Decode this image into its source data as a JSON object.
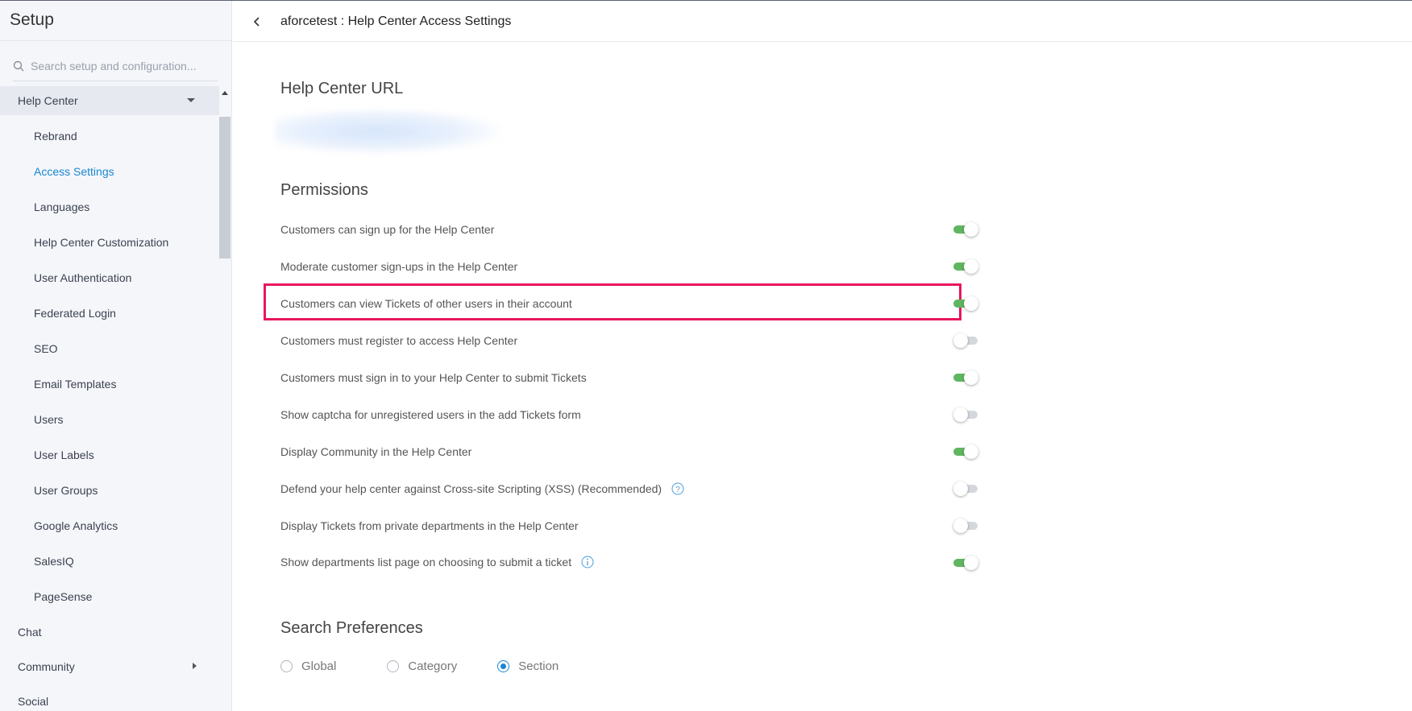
{
  "sidebar": {
    "title": "Setup",
    "search_placeholder": "Search setup and configuration...",
    "items": [
      {
        "label": "Help Center",
        "level": "top",
        "state": "expanded"
      },
      {
        "label": "Rebrand",
        "level": "sub"
      },
      {
        "label": "Access Settings",
        "level": "sub",
        "state": "active"
      },
      {
        "label": "Languages",
        "level": "sub"
      },
      {
        "label": "Help Center Customization",
        "level": "sub"
      },
      {
        "label": "User Authentication",
        "level": "sub"
      },
      {
        "label": "Federated Login",
        "level": "sub"
      },
      {
        "label": "SEO",
        "level": "sub"
      },
      {
        "label": "Email Templates",
        "level": "sub"
      },
      {
        "label": "Users",
        "level": "sub"
      },
      {
        "label": "User Labels",
        "level": "sub"
      },
      {
        "label": "User Groups",
        "level": "sub"
      },
      {
        "label": "Google Analytics",
        "level": "sub"
      },
      {
        "label": "SalesIQ",
        "level": "sub"
      },
      {
        "label": "PageSense",
        "level": "sub"
      },
      {
        "label": "Chat",
        "level": "top"
      },
      {
        "label": "Community",
        "level": "top",
        "state": "collapsed"
      },
      {
        "label": "Social",
        "level": "top"
      }
    ]
  },
  "header": {
    "title": "aforcetest : Help Center Access Settings"
  },
  "main": {
    "help_center_url_title": "Help Center URL",
    "permissions_title": "Permissions",
    "permissions": [
      {
        "label": "Customers can sign up for the Help Center",
        "enabled": true
      },
      {
        "label": "Moderate customer sign-ups in the Help Center",
        "enabled": true
      },
      {
        "label": "Customers can view Tickets of other users in their account",
        "enabled": true,
        "highlighted": true
      },
      {
        "label": "Customers must register to access Help Center",
        "enabled": false
      },
      {
        "label": "Customers must sign in to your Help Center to submit Tickets",
        "enabled": true
      },
      {
        "label": "Show captcha for unregistered users in the add Tickets form",
        "enabled": false
      },
      {
        "label": "Display Community in the Help Center",
        "enabled": true
      },
      {
        "label": "Defend your help center against Cross-site Scripting (XSS) (Recommended)",
        "enabled": false,
        "icon": "question-icon"
      },
      {
        "label": "Display Tickets from private departments in the Help Center",
        "enabled": false
      },
      {
        "label": "Show departments list page on choosing to submit a ticket",
        "enabled": true,
        "icon": "info-icon"
      }
    ],
    "search_preferences_title": "Search Preferences",
    "search_options": [
      {
        "label": "Global",
        "selected": false
      },
      {
        "label": "Category",
        "selected": false
      },
      {
        "label": "Section",
        "selected": true
      }
    ]
  },
  "colors": {
    "accent": "#1a86d0",
    "toggle_on": "#5fb560",
    "highlight": "#e8175d"
  }
}
